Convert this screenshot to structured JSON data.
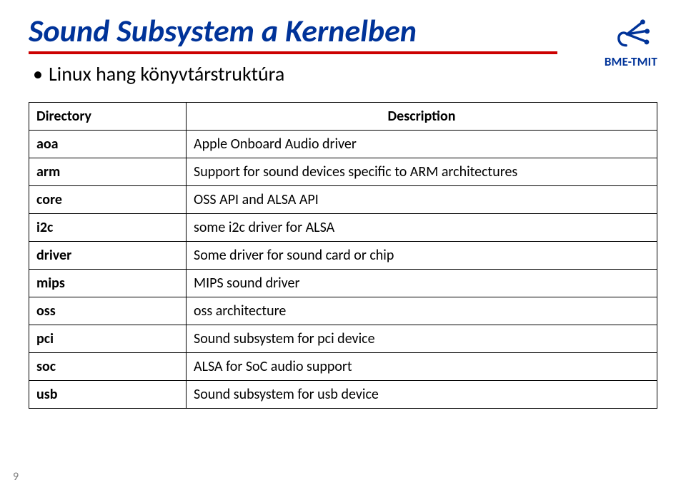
{
  "logo_label": "BME-TMIT",
  "title": "Sound Subsystem a Kernelben",
  "subtitle": "Linux hang könyvtárstruktúra",
  "table": {
    "headers": {
      "directory": "Directory",
      "description": "Description"
    },
    "rows": [
      {
        "dir": "aoa",
        "desc": "Apple Onboard Audio driver"
      },
      {
        "dir": "arm",
        "desc": "Support for sound devices specific to ARM architectures"
      },
      {
        "dir": "core",
        "desc": "OSS API and ALSA API"
      },
      {
        "dir": "i2c",
        "desc": "some i2c driver for ALSA"
      },
      {
        "dir": "driver",
        "desc": "Some driver for sound card or chip"
      },
      {
        "dir": "mips",
        "desc": "MIPS sound driver"
      },
      {
        "dir": "oss",
        "desc": "oss architecture"
      },
      {
        "dir": "pci",
        "desc": "Sound subsystem for pci device"
      },
      {
        "dir": "soc",
        "desc": "ALSA for SoC audio support"
      },
      {
        "dir": "usb",
        "desc": "Sound subsystem for usb device"
      }
    ]
  },
  "page_number": "9"
}
